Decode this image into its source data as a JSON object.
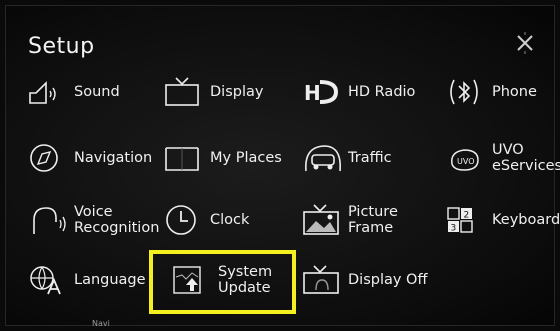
{
  "title": "Setup",
  "items": [
    {
      "label": "Sound"
    },
    {
      "label": "Display"
    },
    {
      "label": "HD Radio"
    },
    {
      "label": "Phone"
    },
    {
      "label": "Navigation"
    },
    {
      "label": "My Places"
    },
    {
      "label": "Traffic"
    },
    {
      "label": "UVO\neServices"
    },
    {
      "label": "Voice\nRecognition"
    },
    {
      "label": "Clock"
    },
    {
      "label": "Picture\nFrame"
    },
    {
      "label": "Keyboard"
    },
    {
      "label": "Language"
    },
    {
      "label": "System\nUpdate"
    },
    {
      "label": "Display Off"
    }
  ],
  "footer_text": "Navi",
  "highlight_color": "#f4ef1f"
}
